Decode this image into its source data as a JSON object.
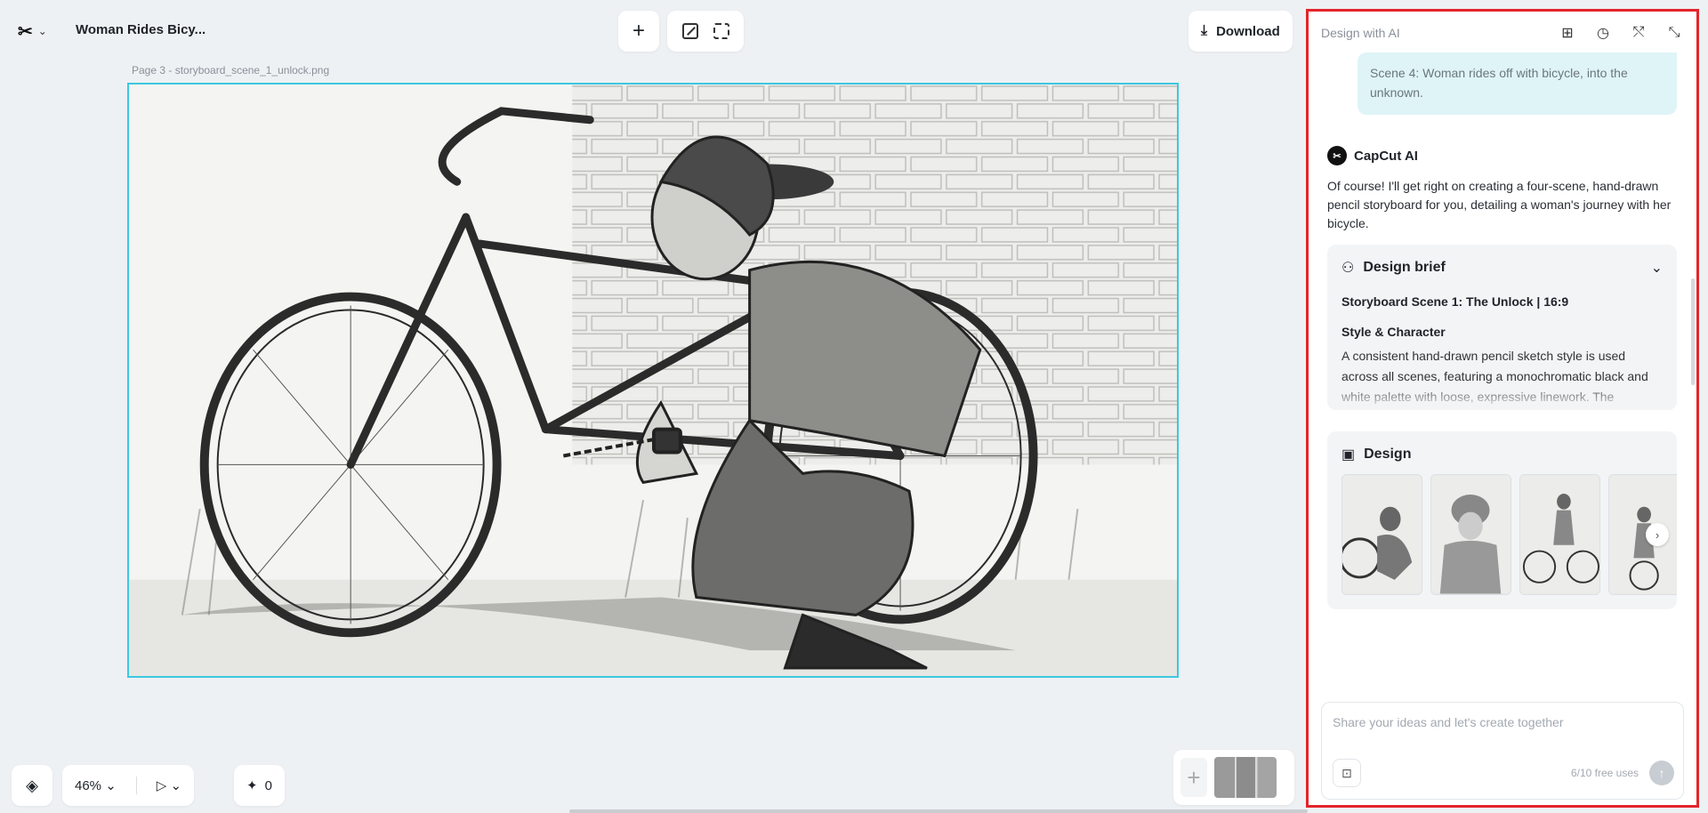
{
  "header": {
    "logo_glyph": "✂",
    "title": "Woman Rides Bicy...",
    "download_label": "Download"
  },
  "canvas": {
    "page_label": "Page 3 -  storyboard_scene_1_unlock.png"
  },
  "bottom_bar": {
    "zoom": "46%",
    "count": "0"
  },
  "panel": {
    "title": "Design with AI",
    "user_message": "Scene 4: Woman rides off with bicycle, into the unknown.",
    "ai_name": "CapCut AI",
    "ai_message": "Of course! I'll get right on creating a four-scene, hand-drawn pencil storyboard for you, detailing a woman's journey with her bicycle.",
    "brief": {
      "title": "Design brief",
      "line1": "Storyboard Scene 1: The Unlock | 16:9",
      "subheading": "Style & Character",
      "text": "A consistent hand-drawn pencil sketch style is used across all scenes, featuring a monochromatic black and white palette with loose, expressive linework. The"
    },
    "design": {
      "title": "Design"
    },
    "composer": {
      "placeholder": "Share your ideas and let's create together",
      "uses": "6/10 free uses"
    }
  },
  "colors": {
    "selection": "#3cc8e0",
    "highlight_border": "#e3252b",
    "user_bubble": "#dff4f7"
  }
}
